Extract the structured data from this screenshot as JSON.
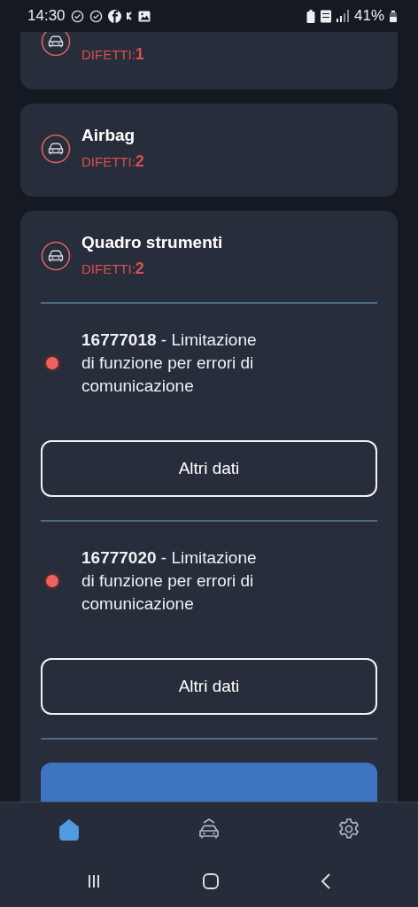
{
  "status_bar": {
    "time": "14:30",
    "battery": "41%"
  },
  "systems": [
    {
      "defects_label": "DIFETTI:",
      "defects": "1"
    },
    {
      "name": "Airbag",
      "defects_label": "DIFETTI:",
      "defects": "2"
    },
    {
      "name": "Quadro strumenti",
      "defects_label": "DIFETTI:",
      "defects": "2",
      "faults": [
        {
          "text": "**16777018** - Limitazione di funzione per errori di comunicazione",
          "button": "Altri dati"
        },
        {
          "text": "**16777020** - Limitazione di funzione per errori di comunicazione",
          "button": "Altri dati"
        }
      ]
    }
  ],
  "reset_button": {
    "kind": "primary"
  },
  "bottom_nav": [
    {
      "kind": "home",
      "selected": true
    },
    {
      "kind": "car",
      "selected": false
    },
    {
      "kind": "settings",
      "selected": false
    }
  ]
}
